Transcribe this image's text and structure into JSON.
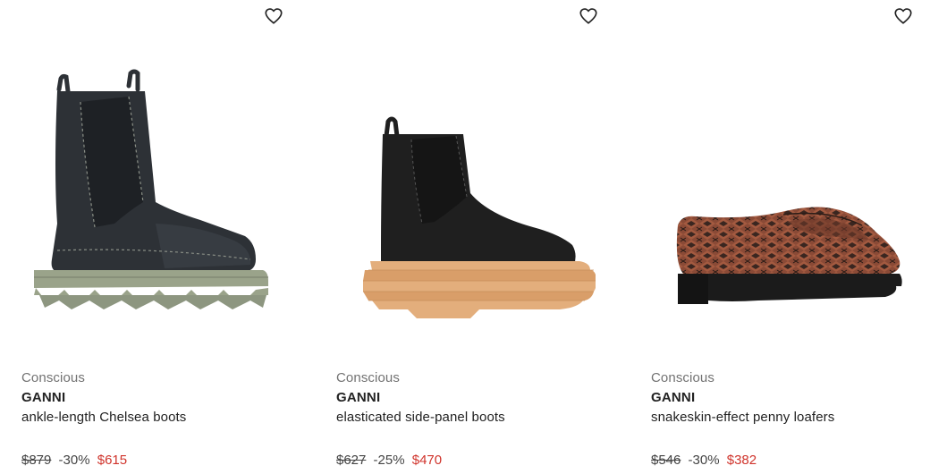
{
  "products": [
    {
      "tag": "Conscious",
      "brand": "GANNI",
      "name": "ankle-length Chelsea boots",
      "old_price": "$879",
      "discount": "-30%",
      "price": "$615",
      "image_icon": "chelsea-boot-olive-sole",
      "colors": {
        "upper": "#2d3136",
        "sole": "#9aa38a"
      }
    },
    {
      "tag": "Conscious",
      "brand": "GANNI",
      "name": "elasticated side-panel boots",
      "old_price": "$627",
      "discount": "-25%",
      "price": "$470",
      "image_icon": "chelsea-boot-tan-sole",
      "colors": {
        "upper": "#1f1f1f",
        "sole": "#e3ae7c"
      }
    },
    {
      "tag": "Conscious",
      "brand": "GANNI",
      "name": "snakeskin-effect penny loafers",
      "old_price": "$546",
      "discount": "-30%",
      "price": "$382",
      "image_icon": "snakeskin-loafer",
      "colors": {
        "upper": "#8a4a36",
        "sole": "#1b1b1b"
      }
    }
  ],
  "icons": {
    "wishlist": "heart-outline-icon"
  },
  "theme": {
    "sale_color": "#d0342c",
    "muted_text": "#727272"
  }
}
